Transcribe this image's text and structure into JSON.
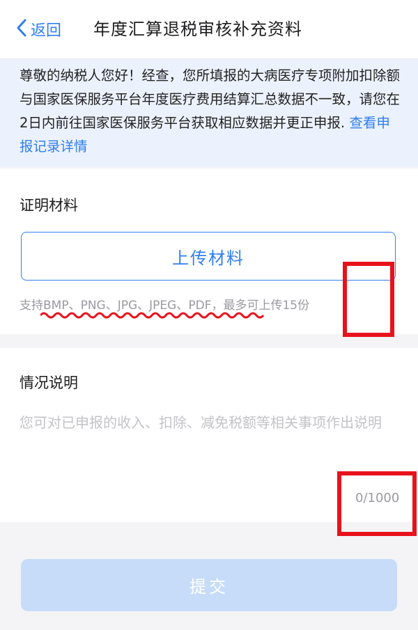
{
  "header": {
    "back_label": "返回",
    "title": "年度汇算退税审核补充资料"
  },
  "notice": {
    "text": "尊敬的纳税人您好！经查，您所填报的大病医疗专项附加扣除额与国家医保服务平台年度医疗费用结算汇总数据不一致，请您在2日内前往国家医保服务平台获取相应数据并更正申报. ",
    "link": "查看申报记录详情"
  },
  "materials": {
    "label": "证明材料",
    "upload_label": "上传材料",
    "support_hint": "支持BMP、PNG、JPG、JPEG、PDF，最多可上传15份"
  },
  "description": {
    "label": "情况说明",
    "placeholder": "您可对已申报的收入、扣除、减免税额等相关事项作出说明",
    "char_count": "0/1000"
  },
  "submit_label": "提交",
  "colors": {
    "accent": "#2f7ef1",
    "annotation_red": "#e8121c",
    "notice_bg": "#ecf2fd",
    "submit_disabled": "#c7dcf8"
  }
}
